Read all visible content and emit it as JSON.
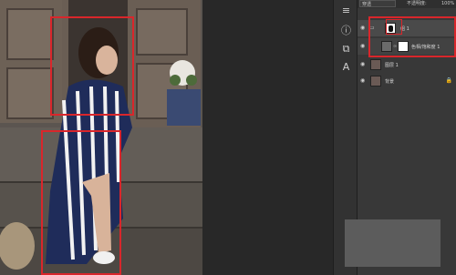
{
  "layers_panel": {
    "blend_mode": "穿透",
    "opacity_label": "不透明度:",
    "opacity_value": "100%",
    "layers": [
      {
        "name": "组 1",
        "type": "group",
        "selected": true
      },
      {
        "name": "色相/饱和度 1",
        "type": "adjustment",
        "selected": true
      },
      {
        "name": "图层 1",
        "type": "pixel",
        "selected": false
      },
      {
        "name": "背景",
        "type": "background",
        "selected": false,
        "locked": true
      }
    ]
  },
  "icons": [
    "info-icon",
    "libraries-icon",
    "character-icon",
    "layers-icon",
    "adjustments-icon"
  ],
  "colors": {
    "annotation_red": "#d9262b",
    "panel_bg": "#383838",
    "selected_row": "#4a4a4a"
  }
}
